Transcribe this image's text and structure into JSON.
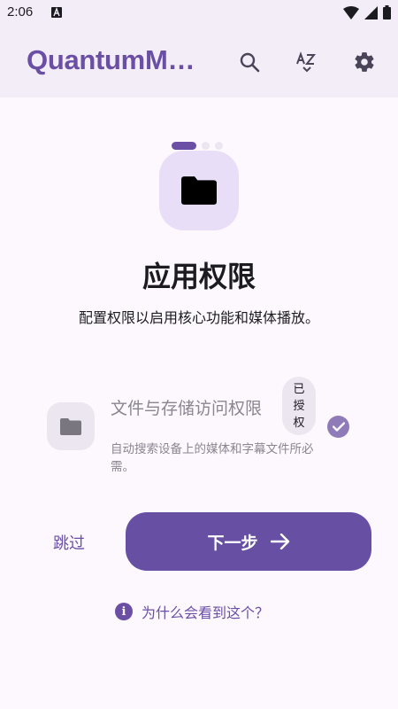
{
  "status_bar": {
    "time": "2:06"
  },
  "app_bar": {
    "title": "QuantumM…",
    "actions": [
      "search-icon",
      "sort-az-icon",
      "gear-icon"
    ]
  },
  "pager": {
    "total": 3,
    "active_index": 0
  },
  "onboarding": {
    "title": "应用权限",
    "subtitle": "配置权限以启用核心功能和媒体播放。"
  },
  "permission": {
    "name": "文件与存储访问权限",
    "status": "已授权",
    "description": "自动搜索设备上的媒体和字幕文件所必需。",
    "granted": true
  },
  "buttons": {
    "skip": "跳过",
    "next": "下一步"
  },
  "help": {
    "why_text": "为什么会看到这个？"
  },
  "colors": {
    "primary": "#6750a4",
    "title_purple": "#6a4fa5",
    "surface": "#fdf8fd",
    "container": "#ece6f0"
  }
}
